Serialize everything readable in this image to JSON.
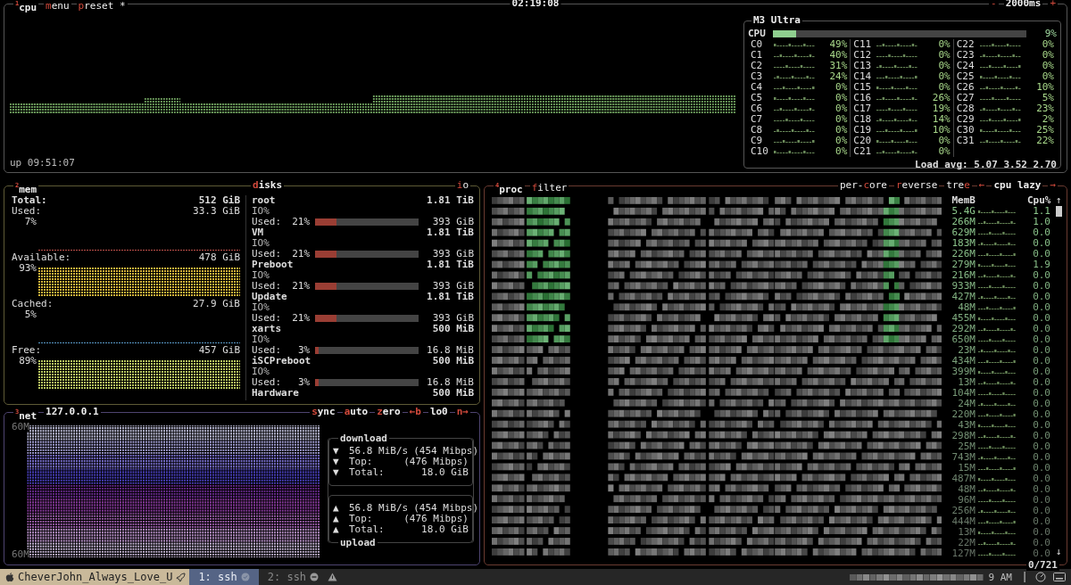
{
  "cpu": {
    "number": "1",
    "title": "cpu",
    "menu": [
      {
        "key": "m",
        "after": "enu"
      },
      {
        "key": "p",
        "after": "reset *"
      }
    ],
    "clock": "02:19:08",
    "interval": {
      "minus": "-",
      "value": "2000ms",
      "plus": "+"
    },
    "uptime": "up 09:51:07",
    "model": "M3 Ultra",
    "total": {
      "label": "CPU",
      "level": 0.09,
      "reading": "9%"
    },
    "cores": [
      {
        "name": "C0",
        "reading": "49%"
      },
      {
        "name": "C1",
        "reading": "40%"
      },
      {
        "name": "C2",
        "reading": "31%"
      },
      {
        "name": "C3",
        "reading": "24%"
      },
      {
        "name": "C4",
        "reading": "0%"
      },
      {
        "name": "C5",
        "reading": "0%"
      },
      {
        "name": "C6",
        "reading": "0%"
      },
      {
        "name": "C7",
        "reading": "0%"
      },
      {
        "name": "C8",
        "reading": "0%"
      },
      {
        "name": "C9",
        "reading": "0%"
      },
      {
        "name": "C10",
        "reading": "0%"
      },
      {
        "name": "C11",
        "reading": "0%"
      },
      {
        "name": "C12",
        "reading": "0%"
      },
      {
        "name": "C13",
        "reading": "0%"
      },
      {
        "name": "C14",
        "reading": "0%"
      },
      {
        "name": "C15",
        "reading": "0%"
      },
      {
        "name": "C16",
        "reading": "26%"
      },
      {
        "name": "C17",
        "reading": "19%"
      },
      {
        "name": "C18",
        "reading": "14%"
      },
      {
        "name": "C19",
        "reading": "10%"
      },
      {
        "name": "C20",
        "reading": "0%"
      },
      {
        "name": "C21",
        "reading": "0%"
      },
      {
        "name": "C22",
        "reading": "0%"
      },
      {
        "name": "C23",
        "reading": "0%"
      },
      {
        "name": "C24",
        "reading": "0%"
      },
      {
        "name": "C25",
        "reading": "0%"
      },
      {
        "name": "C26",
        "reading": "10%"
      },
      {
        "name": "C27",
        "reading": "5%"
      },
      {
        "name": "C28",
        "reading": "23%"
      },
      {
        "name": "C29",
        "reading": "2%"
      },
      {
        "name": "C30",
        "reading": "25%"
      },
      {
        "name": "C31",
        "reading": "22%"
      }
    ],
    "load": "Load avg: 5.07 3.52 2.70"
  },
  "mem": {
    "number": "2",
    "title": "mem",
    "items": [
      {
        "kind": "total",
        "label": "Total:",
        "value": "512 GiB"
      },
      {
        "kind": "line",
        "label": "Used:",
        "value": "33.3 GiB",
        "percent": "7%",
        "color": "#c0504a"
      },
      {
        "kind": "graph",
        "label": "Available:",
        "value": "478 GiB",
        "percent": "93%",
        "color": "#d8b23a"
      },
      {
        "kind": "line",
        "label": "Cached:",
        "value": "27.9 GiB",
        "percent": "5%",
        "color": "#5a9ac8"
      },
      {
        "kind": "graph",
        "label": "Free:",
        "value": "457 GiB",
        "percent": "89%",
        "color": "#b8c860"
      }
    ]
  },
  "disks": {
    "title": {
      "key": "d",
      "after": "isks"
    },
    "io": {
      "key": "i",
      "after": "o"
    },
    "items": [
      {
        "name": "root",
        "size": "1.81 TiB",
        "io": "IO%",
        "used_label": "Used:",
        "used_percent": "21%",
        "level": 0.21,
        "used": "393 GiB"
      },
      {
        "name": "VM",
        "size": "1.81 TiB",
        "io": "IO%",
        "used_label": "Used:",
        "used_percent": "21%",
        "level": 0.21,
        "used": "393 GiB"
      },
      {
        "name": "Preboot",
        "size": "1.81 TiB",
        "io": "IO%",
        "used_label": "Used:",
        "used_percent": "21%",
        "level": 0.21,
        "used": "393 GiB"
      },
      {
        "name": "Update",
        "size": "1.81 TiB",
        "io": "IO%",
        "used_label": "Used:",
        "used_percent": "21%",
        "level": 0.21,
        "used": "393 GiB"
      },
      {
        "name": "xarts",
        "size": "500 MiB",
        "io": "IO%",
        "used_label": "Used:",
        "used_percent": "3%",
        "level": 0.03,
        "used": "16.8 MiB"
      },
      {
        "name": "iSCPreboot",
        "size": "500 MiB",
        "io": "IO%",
        "used_label": "Used:",
        "used_percent": "3%",
        "level": 0.03,
        "used": "16.8 MiB"
      },
      {
        "name": "Hardware",
        "size": "500 MiB"
      }
    ]
  },
  "net": {
    "number": "3",
    "title": "net",
    "address": "127.0.0.1",
    "buttons": [
      {
        "key": "s",
        "after": "ync"
      },
      {
        "key": "a",
        "after": "uto"
      },
      {
        "key": "z",
        "after": "ero"
      },
      {
        "key": "←b"
      },
      {
        "before": "lo0"
      },
      {
        "key": "n→"
      }
    ],
    "scale_top": "60M",
    "scale_bottom": "60M",
    "download": {
      "title": "download",
      "rows": [
        {
          "arrow": "▼",
          "label": "56.8 MiB/s",
          "value": "(454 Mibps)"
        },
        {
          "arrow": "▼",
          "label": "Top:",
          "value": "(476 Mibps)"
        },
        {
          "arrow": "▼",
          "label": "Total:",
          "value": "18.0 GiB"
        }
      ]
    },
    "upload": {
      "title": "upload",
      "rows": [
        {
          "arrow": "▲",
          "label": "56.8 MiB/s",
          "value": "(454 Mibps)"
        },
        {
          "arrow": "▲",
          "label": "Top:",
          "value": "(476 Mibps)"
        },
        {
          "arrow": "▲",
          "label": "Total:",
          "value": "18.0 GiB"
        }
      ]
    }
  },
  "proc": {
    "number": "4",
    "title": "proc",
    "filter": {
      "key": "f",
      "after": "ilter"
    },
    "options": [
      {
        "before": "per-",
        "key": "c",
        "after": "ore"
      },
      {
        "key": "r",
        "after": "everse"
      },
      {
        "before": "tre",
        "key": "e"
      }
    ],
    "sort": {
      "left": "←",
      "label": "cpu lazy",
      "right": "→"
    },
    "columns": [
      "MemB",
      "Cpu%"
    ],
    "scroll_up": "↑",
    "scroll_down": "↓",
    "count": "0/721",
    "rows": [
      {
        "mem": "5.4G",
        "cpu": "1.1"
      },
      {
        "mem": "266M",
        "cpu": "1.0"
      },
      {
        "mem": "629M",
        "cpu": "0.0"
      },
      {
        "mem": "183M",
        "cpu": "0.0"
      },
      {
        "mem": "226M",
        "cpu": "0.0"
      },
      {
        "mem": "279M",
        "cpu": "1.9"
      },
      {
        "mem": "216M",
        "cpu": "0.0"
      },
      {
        "mem": "933M",
        "cpu": "0.0"
      },
      {
        "mem": "427M",
        "cpu": "0.0"
      },
      {
        "mem": "48M",
        "cpu": "0.0"
      },
      {
        "mem": "455M",
        "cpu": "0.0"
      },
      {
        "mem": "292M",
        "cpu": "0.0"
      },
      {
        "mem": "650M",
        "cpu": "0.0"
      },
      {
        "mem": "23M",
        "cpu": "0.0"
      },
      {
        "mem": "434M",
        "cpu": "0.0"
      },
      {
        "mem": "399M",
        "cpu": "0.0"
      },
      {
        "mem": "13M",
        "cpu": "0.0"
      },
      {
        "mem": "104M",
        "cpu": "0.0"
      },
      {
        "mem": "24M",
        "cpu": "0.0"
      },
      {
        "mem": "220M",
        "cpu": "0.0"
      },
      {
        "mem": "43M",
        "cpu": "0.0"
      },
      {
        "mem": "298M",
        "cpu": "0.0"
      },
      {
        "mem": "25M",
        "cpu": "0.0"
      },
      {
        "mem": "743M",
        "cpu": "0.0"
      },
      {
        "mem": "15M",
        "cpu": "0.0"
      },
      {
        "mem": "487M",
        "cpu": "0.0"
      },
      {
        "mem": "48M",
        "cpu": "0.0"
      },
      {
        "mem": "96M",
        "cpu": "0.0"
      },
      {
        "mem": "256M",
        "cpu": "0.0"
      },
      {
        "mem": "444M",
        "cpu": "0.0"
      },
      {
        "mem": "13M",
        "cpu": "0.0"
      },
      {
        "mem": "22M",
        "cpu": "0.0"
      },
      {
        "mem": "127M",
        "cpu": "0.0"
      }
    ]
  },
  "status_bar": {
    "session": "CheverJohn_Always_Love_U",
    "windows": [
      {
        "label": "1: ssh",
        "selected": true
      },
      {
        "label": "2: ssh",
        "selected": false
      }
    ],
    "time": "9 AM"
  }
}
